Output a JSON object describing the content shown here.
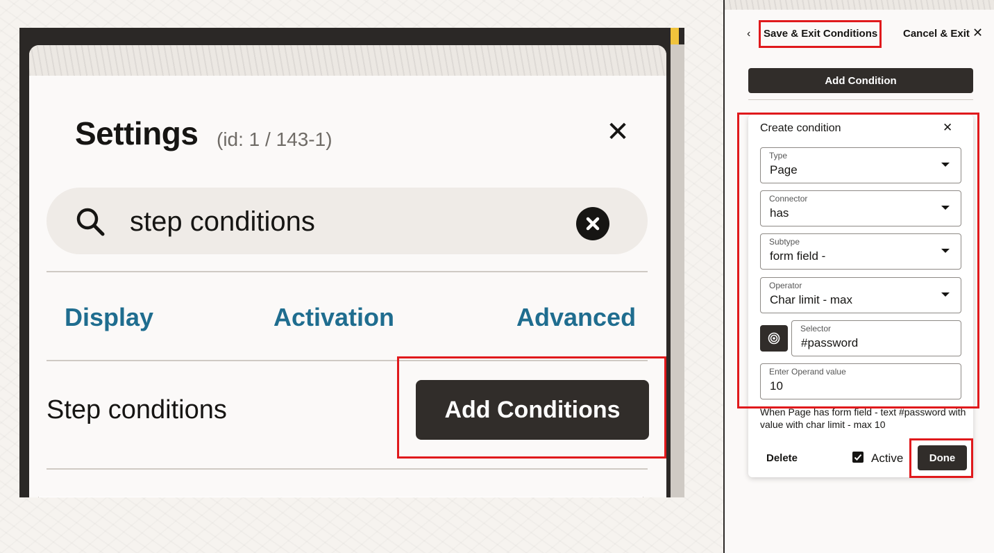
{
  "settings": {
    "title": "Settings",
    "id_label": "(id: 1 / 143-1)",
    "search_value": "step conditions",
    "tabs": [
      "Display",
      "Activation",
      "Advanced"
    ],
    "step_conditions_label": "Step conditions",
    "add_conditions_button": "Add Conditions"
  },
  "conditions_panel": {
    "back_icon": "‹",
    "save_exit": "Save & Exit Conditions",
    "cancel_exit": "Cancel & Exit",
    "close_icon": "✕",
    "add_condition_button": "Add Condition",
    "card": {
      "title": "Create condition",
      "close_icon": "✕",
      "fields": [
        {
          "label": "Type",
          "value": "Page"
        },
        {
          "label": "Connector",
          "value": "has"
        },
        {
          "label": "Subtype",
          "value": "form field -"
        },
        {
          "label": "Operator",
          "value": "Char limit - max"
        },
        {
          "label": "Selector",
          "value": "#password"
        },
        {
          "label": "Enter Operand value",
          "value": "10"
        }
      ],
      "summary": "When Page has form field - text #password with value with char limit - max 10",
      "delete_button": "Delete",
      "active_label": "Active",
      "active_checked": true,
      "done_button": "Done"
    }
  },
  "colors": {
    "highlight": "#e0191c",
    "button_dark": "#312d2a",
    "tab_link": "#1f6d8f"
  }
}
